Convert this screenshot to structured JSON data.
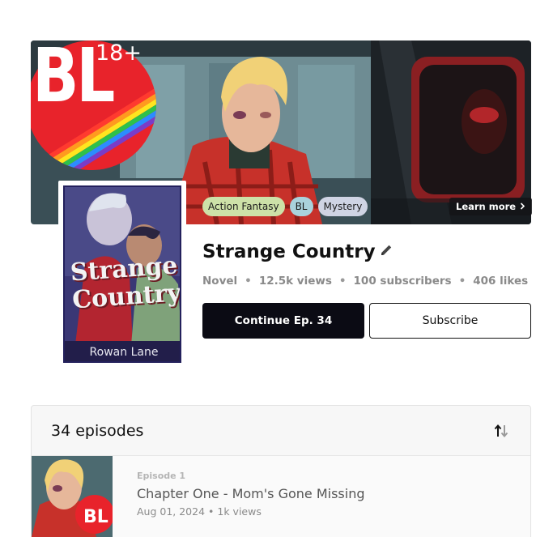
{
  "banner": {
    "badge_text": "BL",
    "badge_age": "18+",
    "genres": [
      "Action Fantasy",
      "BL",
      "Mystery"
    ],
    "learn_more_label": "Learn more",
    "learn_more_icon": "chevron-right-icon"
  },
  "cover": {
    "title_art": "Strange Country",
    "author_art": "Rowan Lane"
  },
  "series": {
    "title": "Strange Country",
    "edit_icon": "pencil-icon",
    "type": "Novel",
    "views": "12.5k views",
    "subscribers": "100 subscribers",
    "likes": "406 likes"
  },
  "actions": {
    "continue_label": "Continue Ep. 34",
    "subscribe_label": "Subscribe"
  },
  "episodes": {
    "count_label": "34 episodes",
    "sort_icon": "sort-icon",
    "items": [
      {
        "number": "Episode 1",
        "title": "Chapter One - Mom's Gone Missing",
        "date": "Aug 01, 2024",
        "views": "1k views"
      }
    ]
  },
  "colors": {
    "primary_button": "#0b0b14",
    "tag_action_fantasy": "#cde1a8",
    "tag_bl": "#a9d2dc",
    "tag_mystery": "#cfd4e4",
    "badge_red": "#e8232b"
  }
}
